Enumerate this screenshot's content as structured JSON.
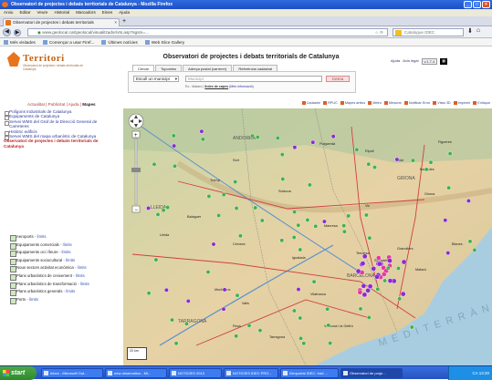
{
  "window": {
    "title": "Observatori de projectes i debats territorials de Catalunya - Mozilla Firefox"
  },
  "menu": [
    "Arxiu",
    "Editar",
    "Veure",
    "Historial",
    "Marcadors",
    "Eines",
    "Ajuda"
  ],
  "tab": {
    "label": "Observatori de projectes i debats territorials"
  },
  "address": {
    "url": "www.geolocal.cat/geolocal/visualitzador/vts.asp?sgsm=...",
    "search_placeholder": "Catalogue IDEC"
  },
  "bookmarks": [
    "Més visitades",
    "Començar a usar Firef...",
    "Últimes notícies",
    "Web Slice Gallery"
  ],
  "logo": {
    "name": "Territori",
    "subtitle": "Observatori de projectes i debats territorials de Catalunya"
  },
  "header": {
    "title": "Observatori de projectes i debats territorials de Catalunya",
    "tools": [
      "Ajuda",
      "Avís legal",
      "v.1.7.4"
    ]
  },
  "search": {
    "tabs": [
      "Cercar",
      "Toponims",
      "Adreça postal (carrerer)",
      "Referència cadastral"
    ],
    "type": "Escull un municipi",
    "input_placeholder": "Municipi",
    "button": "Cerca",
    "hint_pre": "Ex.: Mataró |",
    "hint_bold": "Índex de capes",
    "hint_more": "(Més informació)"
  },
  "nav": {
    "pre": "Actualitat",
    "links": [
      "Publicitat",
      "Ajuda",
      "Mapes"
    ]
  },
  "tree": [
    "Polígons Industrials de Catalunya",
    "Equipaments de Catalunya",
    "Servei WMS del Graf de la Direcció General de Carreteres",
    "Històric edificis",
    "Servei WMS del mapa urbanístic de Catalunya",
    "Observatori de projectes i debats territorials de Catalunya"
  ],
  "maptools": [
    "Cadastre",
    "RPUC",
    "Mapes antics",
    "Metro",
    "Mesurar",
    "Notificar Error",
    "Vista 3D",
    "Imprimir",
    "Enllaçar"
  ],
  "layers": [
    {
      "label": "Aeroports",
      "link": "- límits"
    },
    {
      "label": "Equipaments comercials",
      "link": "- límits"
    },
    {
      "label": "Equipaments oci i lleure",
      "link": "- límits"
    },
    {
      "label": "Equipaments sociocultural",
      "link": "- límits"
    },
    {
      "label": "Nous sectors activitat econòmica",
      "link": "- límits"
    },
    {
      "label": "Plans urbanístics de creixement",
      "link": "- límits"
    },
    {
      "label": "Plans urbanístics de transformació",
      "link": "- límits"
    },
    {
      "label": "Plans urbanístics generals",
      "link": "- límits"
    },
    {
      "label": "Ports",
      "link": "- límits"
    }
  ],
  "map": {
    "regions": [
      "ANDORRA",
      "GIRONA",
      "LLEIDA",
      "BARCELONA",
      "TARRAGONA"
    ],
    "places": [
      "Puigcerdà",
      "Ripoll",
      "Olot",
      "Figueres",
      "Banyoles",
      "Sort",
      "Tremp",
      "Solsona",
      "Manresa",
      "Vic",
      "Girona",
      "Blanes",
      "Mataró",
      "Terrassa",
      "Sabadell",
      "Granollers",
      "Lleida",
      "Balaguer",
      "Cervera",
      "Igualada",
      "Vilafranca",
      "Vilanova i la Geltrú",
      "Reus",
      "Tarragona",
      "Valls",
      "Montblanc"
    ],
    "sea": "MEDITERRÀNIA",
    "scale": "20 km"
  },
  "taskbar": {
    "start": "start",
    "apps": [
      "Inbox - Microsoft Out...",
      "new observation - Mi...",
      "NOTICIES 2013",
      "NOTICIES IDEC PRO...",
      "Geoportal IDEC: Inici ...",
      "Observatori de proje..."
    ],
    "clock": "CA  13:20"
  },
  "colors": {
    "accent": "#e8741c",
    "point_green": "#3fb24a",
    "point_purple": "#8a2ad0",
    "point_pink": "#e23a9a"
  }
}
